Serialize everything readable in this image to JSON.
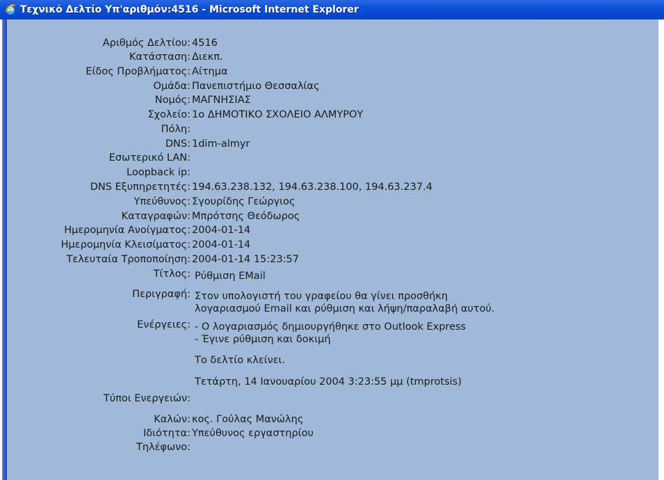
{
  "window": {
    "title": "Τεχνικό Δελτίο Υπ'αριθμόν:4516 - Microsoft Internet Explorer"
  },
  "ticket": {
    "number": {
      "label": "Αριθμός Δελτίου:",
      "value": "4516"
    },
    "status": {
      "label": "Κατάσταση:",
      "value": "Διεκπ."
    },
    "problem_type": {
      "label": "Είδος Προβλήματος:",
      "value": "Αίτημα"
    },
    "group": {
      "label": "Ομάδα:",
      "value": "Πανεπιστήμιο Θεσσαλίας"
    },
    "prefecture": {
      "label": "Νομός:",
      "value": "ΜΑΓΝΗΣΙΑΣ"
    },
    "school": {
      "label": "Σχολείο:",
      "value": "1ο ΔΗΜΟΤΙΚΟ ΣΧΟΛΕΙΟ ΑΛΜΥΡΟΥ"
    },
    "city": {
      "label": "Πόλη:",
      "value": ""
    },
    "dns": {
      "label": "DNS:",
      "value": "1dim-almyr"
    },
    "internal_lan": {
      "label": "Εσωτερικό LAN:",
      "value": ""
    },
    "loopback_ip": {
      "label": "Loopback ip:",
      "value": ""
    },
    "dns_servers": {
      "label": "DNS Εξυπηρετητές:",
      "value": "194.63.238.132, 194.63.238.100, 194.63.237.4"
    },
    "responsible": {
      "label": "Υπεύθυνος:",
      "value": "Σγουρίδης Γεώργιος"
    },
    "recorder": {
      "label": "Καταγραφών:",
      "value": "Μπρότσης Θεόδωρος"
    },
    "open_date": {
      "label": "Ημερομηνία Ανοίγματος:",
      "value": "2004-01-14"
    },
    "close_date": {
      "label": "Ημερομηνία Κλεισίματος:",
      "value": "2004-01-14"
    },
    "last_modified": {
      "label": "Τελευταία Τροποποίηση:",
      "value": "2004-01-14 15:23:57"
    },
    "title": {
      "label": "Τίτλος:",
      "value": "Ρύθμιση EMail"
    },
    "description": {
      "label": "Περιγραφή:",
      "lines": [
        "Στον υπολογιστή του γραφείου θα γίνει προσθήκη",
        "λογαριασμού Email και ρύθμιση και λήψη/παραλαβή αυτού."
      ]
    },
    "actions": {
      "label": "Ενέργειες:",
      "lines": [
        "- Ο λογαριασμός δημιουργήθηκε στο Outlook Express",
        "- Έγινε ρύθμιση και δοκιμή"
      ],
      "closing_note": "Το δελτίο κλείνει.",
      "signature": "Τετάρτη, 14 Ιανουαρίου 2004 3:23:55 μμ (tmprotsis)"
    },
    "action_types": {
      "label": "Τύποι Ενεργειών:",
      "value": ""
    },
    "caller": {
      "label": "Καλών:",
      "value": "κος. Γούλας Μανώλης"
    },
    "capacity": {
      "label": "Ιδιότητα:",
      "value": "Υπεύθυνος εργαστηρίου"
    },
    "phone": {
      "label": "Τηλέφωνο:",
      "value": ""
    }
  }
}
